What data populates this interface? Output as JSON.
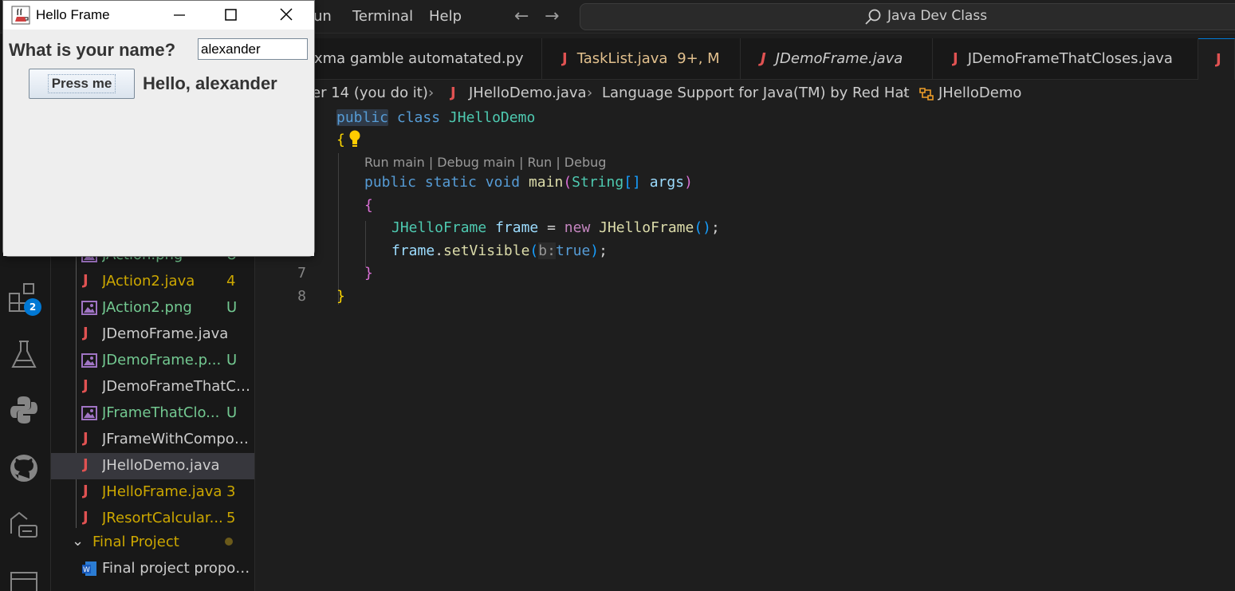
{
  "menu": {
    "run": "un",
    "terminal": "Terminal",
    "help": "Help"
  },
  "command_center": {
    "label": "Java Dev Class"
  },
  "tabs": [
    {
      "label": "xma gamble automatated.py",
      "color": "#cccccc",
      "italic": false
    },
    {
      "label": "TaskList.java",
      "badge": "9+, M",
      "color": "#e2c08d",
      "italic": false
    },
    {
      "label": "JDemoFrame.java",
      "color": "#cccccc",
      "italic": true
    },
    {
      "label": "JDemoFrameThatCloses.java",
      "color": "#cccccc",
      "italic": false
    }
  ],
  "breadcrumb": {
    "folder": "er 14 (you do it)",
    "file": "JHelloDemo.java",
    "ext": "Language Support for Java(TM) by Red Hat",
    "symbol": "JHelloDemo"
  },
  "activity": {
    "extensions_badge": "2"
  },
  "sidebar": {
    "files": [
      {
        "name": "JAction.png",
        "type": "image",
        "badge": "U",
        "color": "#73c991"
      },
      {
        "name": "JAction2.java",
        "type": "java",
        "badge": "4",
        "color": "#cca700"
      },
      {
        "name": "JAction2.png",
        "type": "image",
        "badge": "U",
        "color": "#73c991"
      },
      {
        "name": "JDemoFrame.java",
        "type": "java",
        "badge": "",
        "color": "#cccccc"
      },
      {
        "name": "JDemoFrame.p...",
        "type": "image",
        "badge": "U",
        "color": "#73c991"
      },
      {
        "name": "JDemoFrameThatCl...",
        "type": "java",
        "badge": "",
        "color": "#cccccc"
      },
      {
        "name": "JFrameThatClo...",
        "type": "image",
        "badge": "U",
        "color": "#73c991"
      },
      {
        "name": "JFrameWithCompon...",
        "type": "java",
        "badge": "",
        "color": "#cccccc"
      },
      {
        "name": "JHelloDemo.java",
        "type": "java",
        "badge": "",
        "color": "#cccccc",
        "selected": true
      },
      {
        "name": "JHelloFrame.java",
        "type": "java",
        "badge": "3",
        "color": "#cca700"
      },
      {
        "name": "JResortCalcular...",
        "type": "java",
        "badge": "5",
        "color": "#cca700"
      }
    ],
    "folder": {
      "name": "Final Project",
      "color": "#cca700"
    },
    "folder_files": [
      {
        "name": "Final project propos...",
        "type": "word"
      }
    ]
  },
  "editor": {
    "line_numbers": [
      "7",
      "8"
    ],
    "codelens": "Run main | Debug main | Run | Debug",
    "lines": {
      "l1_kw1": "public",
      "l1_kw2": "class",
      "l1_cls": "JHelloDemo",
      "l2_brace": "{",
      "l3_kw1": "public",
      "l3_kw2": "static",
      "l3_kw3": "void",
      "l3_fn": "main",
      "l3_p1": "(",
      "l3_cls": "String",
      "l3_arr": "[]",
      "l3_var": "args",
      "l3_p2": ")",
      "l4_brace": "{",
      "l5_cls1": "JHelloFrame",
      "l5_var": "frame",
      "l5_eq": " = ",
      "l5_kw": "new",
      "l5_cls2": "JHelloFrame",
      "l5_paren": "()",
      "l5_semi": ";",
      "l6_var": "frame",
      "l6_dot": ".",
      "l6_fn": "setVisible",
      "l6_p1": "(",
      "l6_inlay": "b:",
      "l6_kw": "true",
      "l6_p2": ")",
      "l6_semi": ";",
      "l7_brace": "}",
      "l8_brace": "}"
    }
  },
  "swing_window": {
    "title": "Hello Frame",
    "prompt_label": "What is your name?",
    "name_input_value": "alexander",
    "button_label": "Press me",
    "greeting": "Hello, alexander"
  }
}
